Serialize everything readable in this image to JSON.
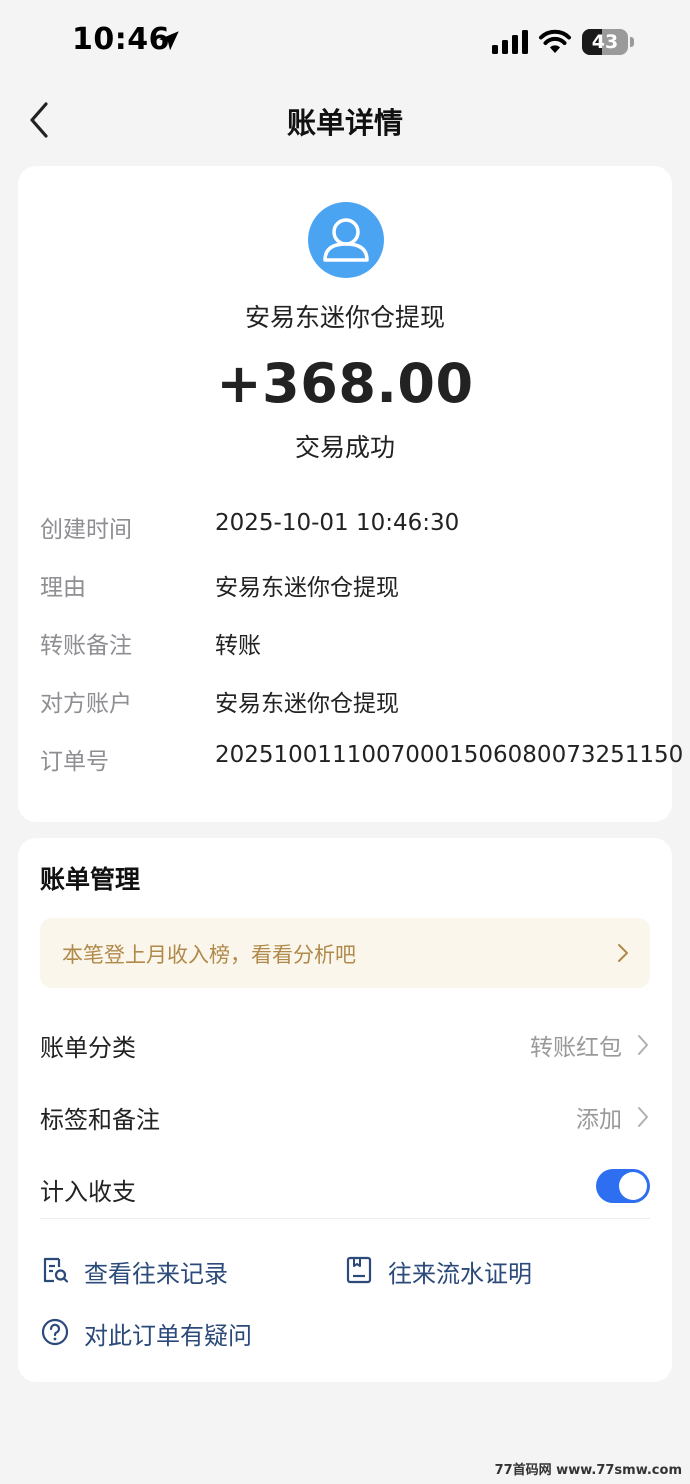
{
  "status_bar": {
    "time": "10:46",
    "battery_level": "43",
    "battery_fraction": 0.43
  },
  "nav": {
    "title": "账单详情"
  },
  "transaction": {
    "merchant": "安易东迷你仓提现",
    "amount": "+368.00",
    "status": "交易成功",
    "details": [
      {
        "label": "创建时间",
        "value": "2025-10-01 10:46:30"
      },
      {
        "label": "理由",
        "value": "安易东迷你仓提现"
      },
      {
        "label": "转账备注",
        "value": "转账"
      },
      {
        "label": "对方账户",
        "value": "安易东迷你仓提现"
      },
      {
        "label": "订单号",
        "value": "20251001110070001506080073251150"
      }
    ]
  },
  "management": {
    "title": "账单管理",
    "banner": "本笔登上月收入榜，看看分析吧",
    "category_label": "账单分类",
    "category_value": "转账红包",
    "tags_label": "标签和备注",
    "tags_value": "添加",
    "count_label": "计入收支",
    "count_enabled": true,
    "links": {
      "history": "查看往来记录",
      "proof": "往来流水证明",
      "question": "对此订单有疑问"
    }
  },
  "watermark": "77首码网 www.77smw.com",
  "colors": {
    "accent": "#2d6ff0",
    "avatar": "#4ba4f2",
    "link": "#2b4a7a",
    "banner_bg": "#fbf6ec",
    "banner_text": "#b08a4a"
  }
}
